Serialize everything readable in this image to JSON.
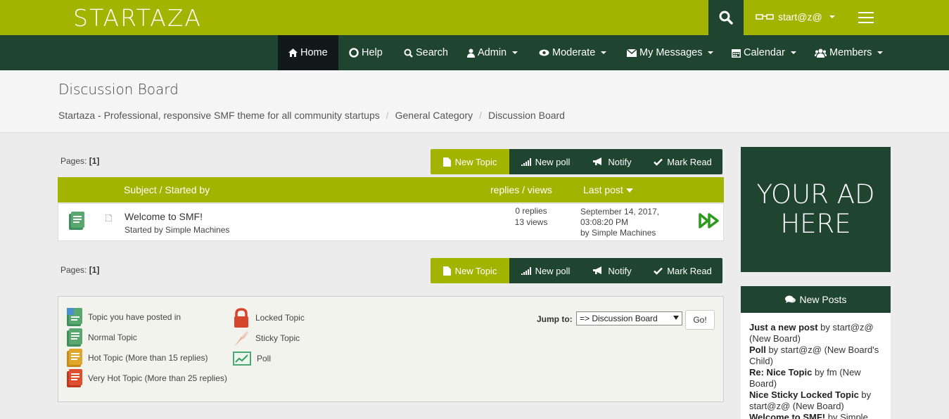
{
  "topbar": {
    "logo": "STARTAZA",
    "username": "start@z@",
    "colors": {
      "brand": "#a2b300",
      "dark": "#1f4530"
    }
  },
  "nav": {
    "items": [
      {
        "label": "Home",
        "icon": "home-icon"
      },
      {
        "label": "Help",
        "icon": "lifebuoy-icon"
      },
      {
        "label": "Search",
        "icon": "search-icon"
      },
      {
        "label": "Admin",
        "icon": "user-icon"
      },
      {
        "label": "Moderate",
        "icon": "eye-icon"
      },
      {
        "label": "My Messages",
        "icon": "envelope-icon"
      },
      {
        "label": "Calendar",
        "icon": "calendar-icon"
      },
      {
        "label": "Members",
        "icon": "users-icon"
      }
    ]
  },
  "header": {
    "title": "Discussion Board",
    "breadcrumb": [
      "Startaza - Professional, responsive SMF theme for all community startups",
      "General Category",
      "Discussion Board"
    ]
  },
  "pagination": {
    "label": "Pages:",
    "current": "[1]"
  },
  "buttons": {
    "new_topic": "New Topic",
    "new_poll": "New poll",
    "notify": "Notify",
    "mark_read": "Mark Read"
  },
  "table": {
    "col_subject": "Subject / Started by",
    "col_stats": "replies / views",
    "col_last": "Last post",
    "rows": [
      {
        "subject": "Welcome to SMF!",
        "started_by": "Started by Simple Machines",
        "replies": "0 replies",
        "views": "13 views",
        "last_line1": "September 14, 2017,",
        "last_line2": "03:08:20 PM",
        "last_line3": "by Simple Machines"
      }
    ]
  },
  "legend": {
    "items": [
      "Topic you have posted in",
      "Normal Topic",
      "Hot Topic (More than 15 replies)",
      "Very Hot Topic (More than 25 replies)",
      "Locked Topic",
      "Sticky Topic",
      "Poll"
    ],
    "jump_label": "Jump to:",
    "jump_value": "=> Discussion Board",
    "go": "Go!"
  },
  "sidebar": {
    "ad_line1": "YOUR AD",
    "ad_line2": "HERE",
    "new_posts_title": "New Posts",
    "posts": [
      {
        "title": "Just a new post",
        "meta": " by start@z@ (New Board)"
      },
      {
        "title": "Poll",
        "meta": " by start@z@ (New Board's Child)"
      },
      {
        "title": "Re: Nice Topic",
        "meta": " by fm (New Board)"
      },
      {
        "title": "Nice Sticky Locked Topic",
        "meta": " by start@z@ (New Board)"
      },
      {
        "title": "Welcome to SMF!",
        "meta": " by Simple Machines"
      }
    ]
  }
}
